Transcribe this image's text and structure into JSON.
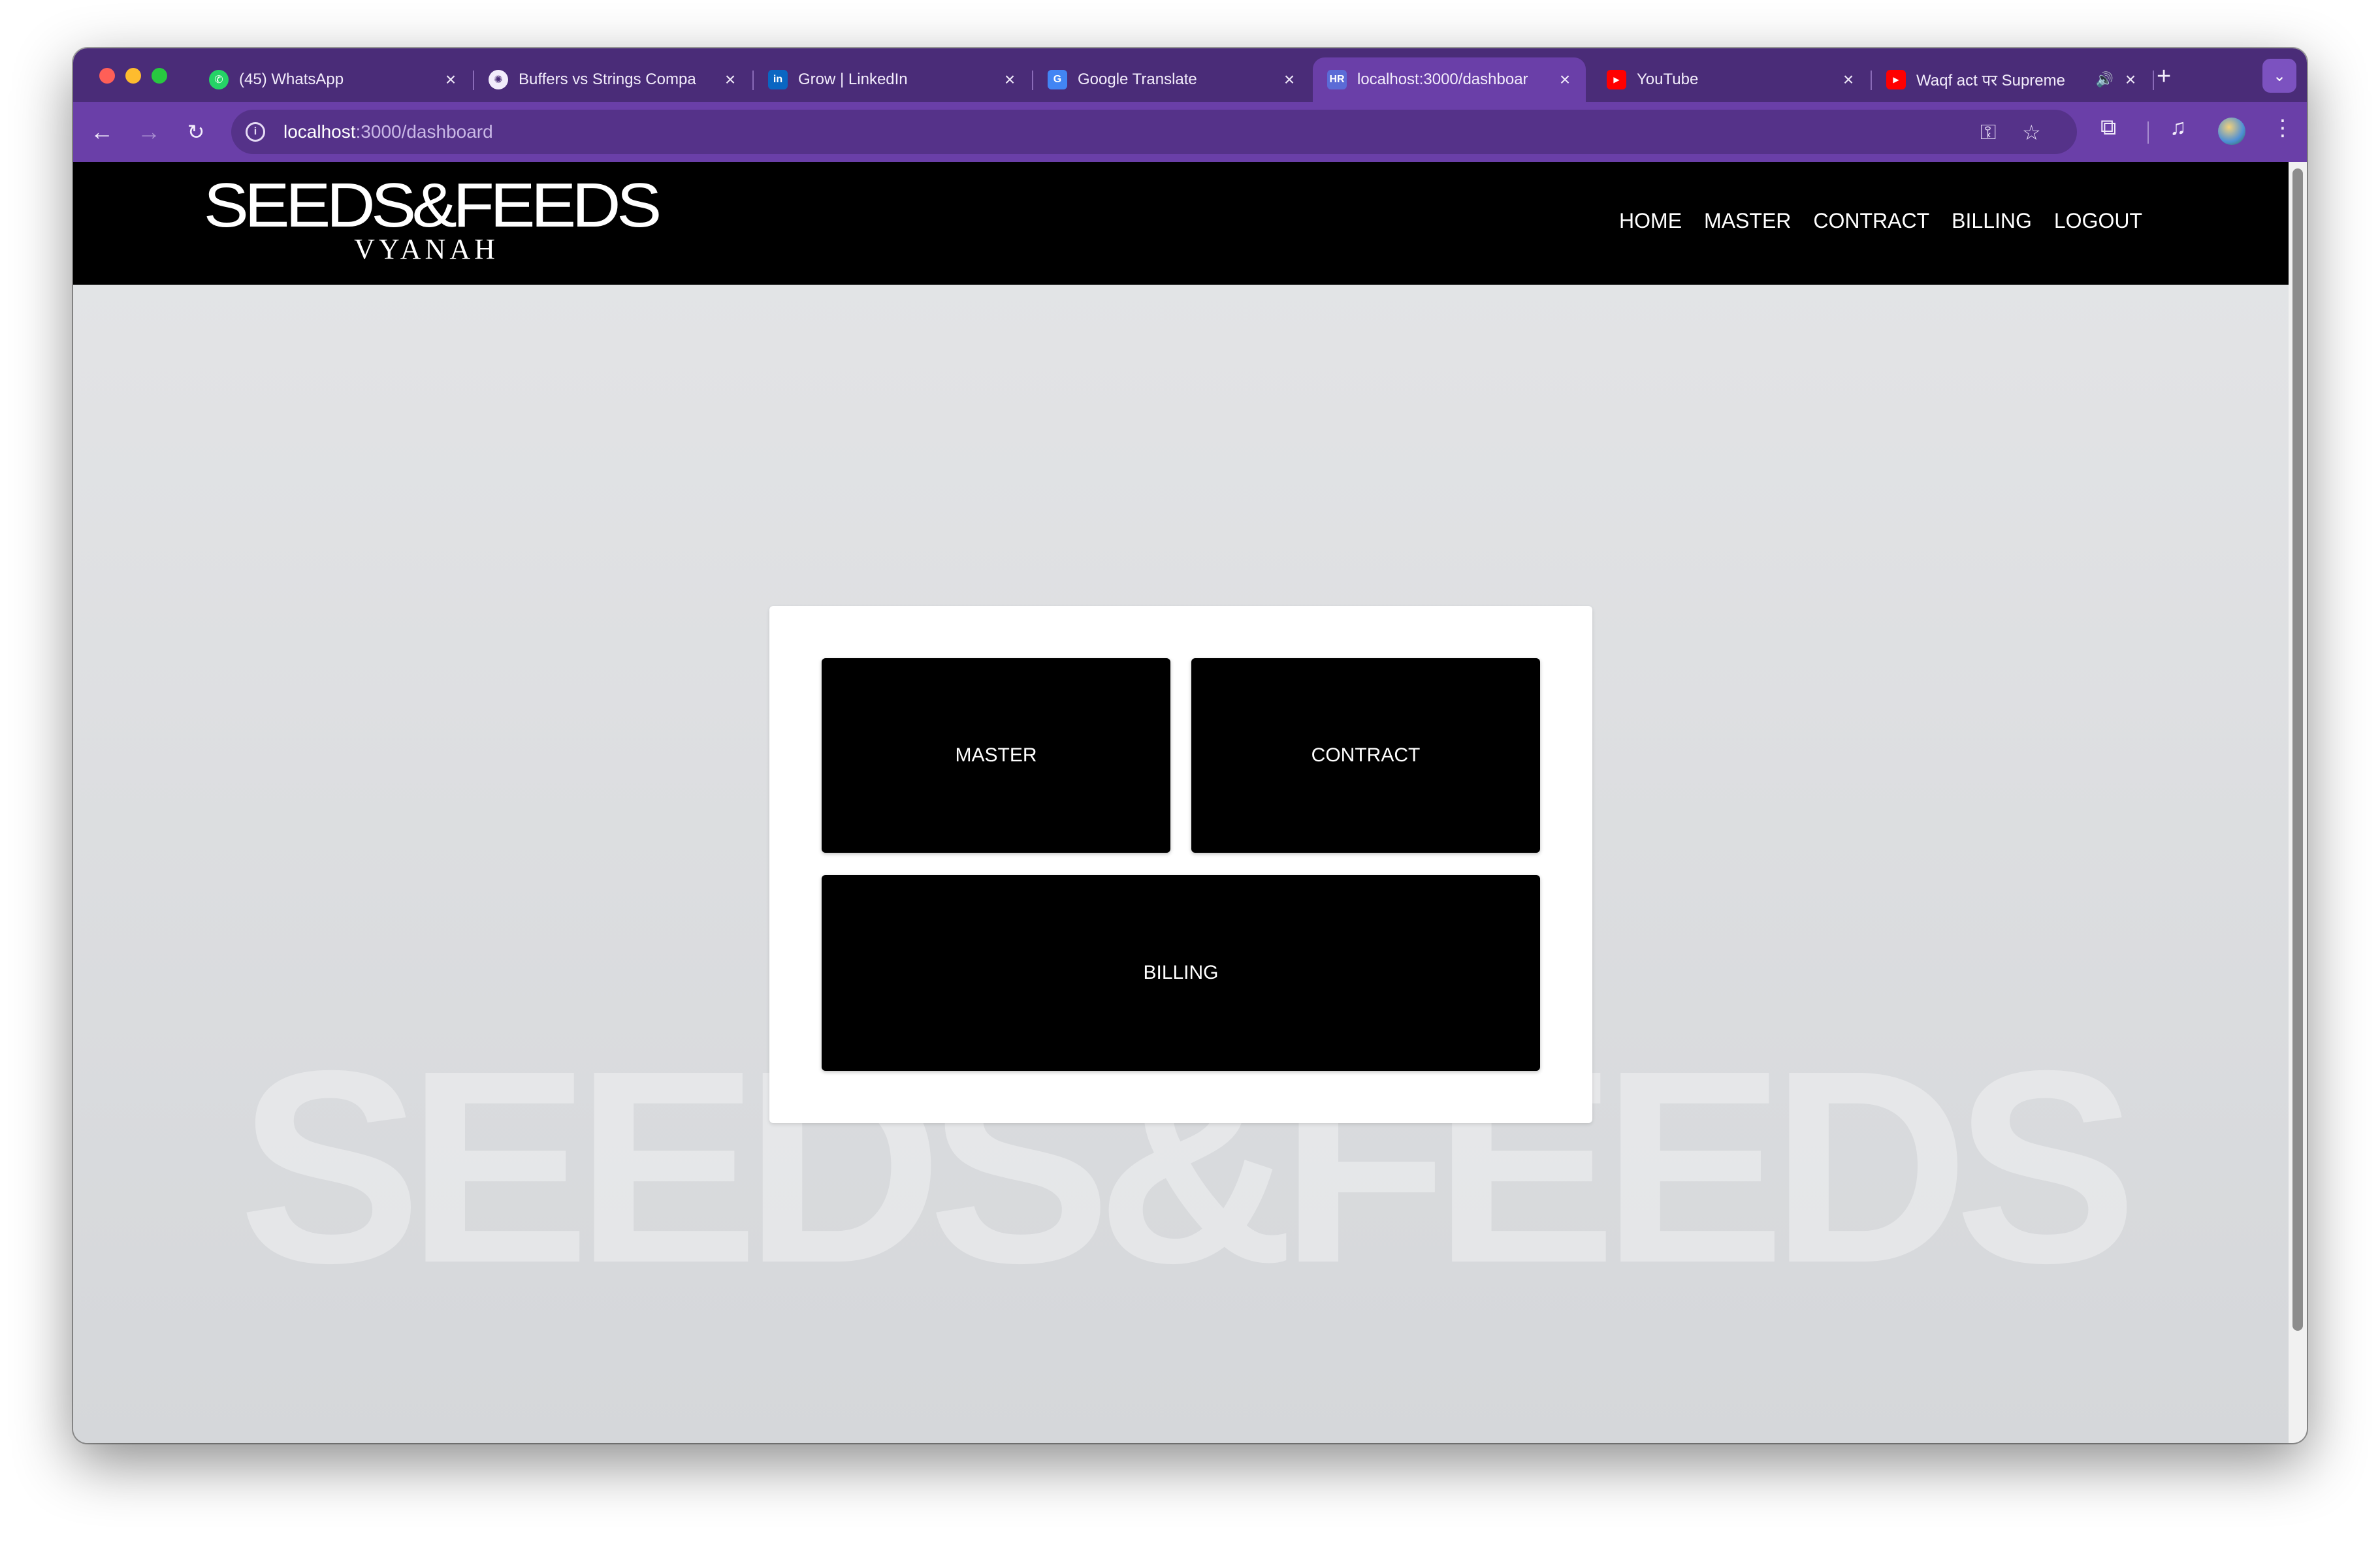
{
  "browser": {
    "tabs": [
      {
        "title": "(45) WhatsApp",
        "icon": "whatsapp-icon",
        "active": false
      },
      {
        "title": "Buffers vs Strings Compa",
        "icon": "openai-icon",
        "active": false
      },
      {
        "title": "Grow | LinkedIn",
        "icon": "linkedin-icon",
        "active": false
      },
      {
        "title": "Google Translate",
        "icon": "google-translate-icon",
        "active": false
      },
      {
        "title": "localhost:3000/dashboar",
        "icon": "hr-favicon",
        "favicon_text": "HR",
        "active": true
      },
      {
        "title": "YouTube",
        "icon": "youtube-icon",
        "active": false
      },
      {
        "title": "Waqf act पर Supreme",
        "icon": "youtube-icon",
        "active": false,
        "audio": true
      }
    ],
    "url_host": "localhost",
    "url_path": ":3000/dashboard",
    "colors": {
      "tab_strip": "#4a2c78",
      "toolbar": "#6a3fa8"
    }
  },
  "header": {
    "brand_main": "SEEDS&FEEDS",
    "brand_sub": "VYANAH",
    "nav": [
      "HOME",
      "MASTER",
      "CONTRACT",
      "BILLING",
      "LOGOUT"
    ]
  },
  "dashboard": {
    "tiles": [
      "MASTER",
      "CONTRACT",
      "BILLING"
    ]
  },
  "watermark": "SEEDS&FEEDS"
}
